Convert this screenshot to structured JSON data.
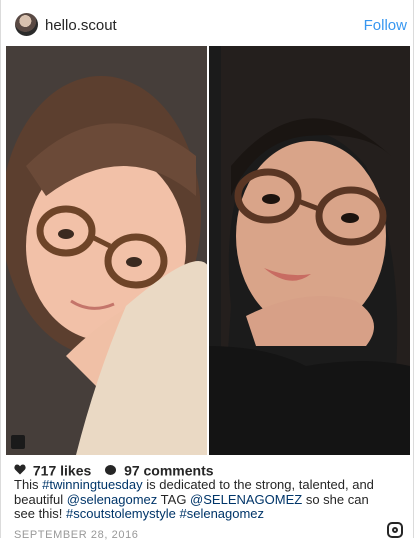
{
  "header": {
    "username": "hello.scout",
    "follow_label": "Follow"
  },
  "photo": {
    "avatar_icon": "avatar-icon",
    "badge_icon": "user-tag-icon"
  },
  "stats": {
    "likes": "717 likes",
    "comments": "97 comments"
  },
  "caption": {
    "text_1": "This ",
    "hashtag_1": "#twinningtuesday",
    "text_2": " is dedicated to the strong, talented, and beautiful ",
    "mention_1": "@selenagomez",
    "text_3": " TAG ",
    "mention_2": "@SELENAGOMEZ",
    "text_4": " so she can see this! ",
    "hashtag_2": "#scoutstolemystyle",
    "hashtag_3": "#selenagomez"
  },
  "date": "SEPTEMBER 28, 2016",
  "colors": {
    "link_blue": "#3897f0",
    "tag_color": "#003569",
    "text": "#262626"
  }
}
